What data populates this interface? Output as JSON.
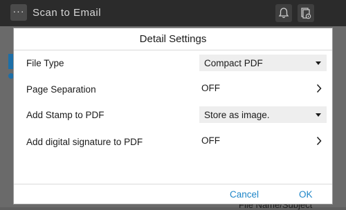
{
  "app": {
    "title": "Scan to Email",
    "menu_glyph": "···",
    "icons": [
      "bell-icon",
      "document-info-icon"
    ]
  },
  "background": {
    "partial_text": "File Name/Subject"
  },
  "dialog": {
    "title": "Detail Settings",
    "rows": [
      {
        "label": "File Type",
        "value": "Compact PDF",
        "control": "dropdown"
      },
      {
        "label": "Page Separation",
        "value": "OFF",
        "control": "link"
      },
      {
        "label": "Add Stamp to PDF",
        "value": "Store as image.",
        "control": "dropdown"
      },
      {
        "label": "Add digital signature to PDF",
        "value": "OFF",
        "control": "link"
      }
    ],
    "buttons": {
      "cancel": "Cancel",
      "ok": "OK"
    }
  },
  "colors": {
    "accent": "#1e86c8",
    "topbar": "#2b2b2b",
    "dropdown_bg": "#eeeeee"
  }
}
